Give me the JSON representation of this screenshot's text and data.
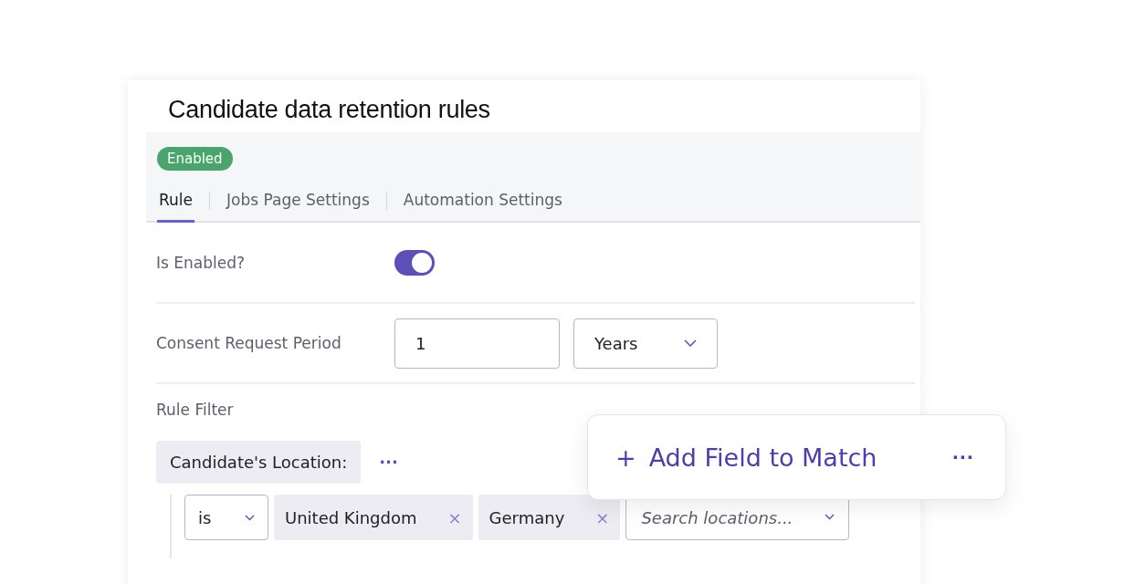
{
  "title": "Candidate data retention rules",
  "status_badge": "Enabled",
  "tabs": [
    {
      "label": "Rule",
      "selected": true
    },
    {
      "label": "Jobs Page Settings",
      "selected": false
    },
    {
      "label": "Automation Settings",
      "selected": false
    }
  ],
  "is_enabled": {
    "label": "Is Enabled?",
    "on": true
  },
  "consent_period": {
    "label": "Consent Request Period",
    "value": "1",
    "unit": "Years"
  },
  "rule_filter": {
    "label": "Rule Filter",
    "field": "Candidate's Location:",
    "more": "···",
    "operator": "is",
    "values": [
      {
        "label": "United Kingdom",
        "remove": "×"
      },
      {
        "label": "Germany",
        "remove": "×"
      }
    ],
    "search_placeholder": "Search locations..."
  },
  "popup": {
    "plus": "+",
    "label": "Add Field to Match",
    "more": "···"
  }
}
